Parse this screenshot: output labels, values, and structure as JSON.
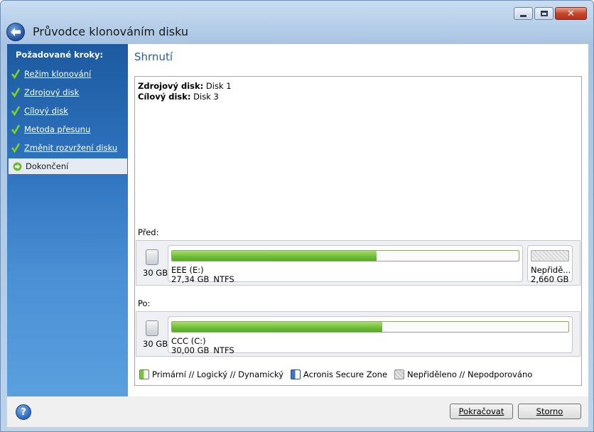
{
  "window": {
    "title": "Průvodce klonováním disku",
    "controls": [
      "minimize-icon",
      "maximize-icon",
      "close-icon"
    ]
  },
  "sidebar": {
    "heading": "Požadované kroky:",
    "steps": [
      {
        "label": "Režim klonování",
        "state": "done"
      },
      {
        "label": "Zdrojový disk",
        "state": "done"
      },
      {
        "label": "Cílový disk",
        "state": "done"
      },
      {
        "label": "Metoda přesunu",
        "state": "done"
      },
      {
        "label": "Změnit rozvržení disku",
        "state": "done"
      },
      {
        "label": "Dokončení",
        "state": "current"
      }
    ]
  },
  "main": {
    "title": "Shrnutí",
    "source_label": "Zdrojový disk:",
    "source_value": " Disk 1",
    "target_label": "Cílový disk:",
    "target_value": " Disk 3",
    "before_label": "Před:",
    "after_label": "Po:",
    "before_disk": {
      "size": "30 GB",
      "partitions": [
        {
          "name": "EEE (E:)",
          "size": "27,34 GB",
          "fs": "NTFS",
          "used_fraction": 0.59,
          "kind": "primary"
        },
        {
          "name": "Nepřidě...",
          "size": "2,660 GB",
          "fs": "",
          "kind": "unallocated"
        }
      ]
    },
    "after_disk": {
      "size": "30 GB",
      "partitions": [
        {
          "name": "CCC (C:)",
          "size": "30,00 GB",
          "fs": "NTFS",
          "used_fraction": 0.53,
          "kind": "primary"
        }
      ]
    },
    "legend": [
      {
        "label": "Primární // Logický // Dynamický",
        "swatch": "green"
      },
      {
        "label": "Acronis Secure Zone",
        "swatch": "blue"
      },
      {
        "label": "Nepřiděleno // Nepodporováno",
        "swatch": "gray"
      }
    ]
  },
  "footer": {
    "help": "?",
    "continue_label": "Pokračovat",
    "cancel_label": "Storno"
  },
  "colors": {
    "accent": "#2a5aa5",
    "sidebar": "#2f73bf",
    "bar_fill": "#6cbd35"
  }
}
